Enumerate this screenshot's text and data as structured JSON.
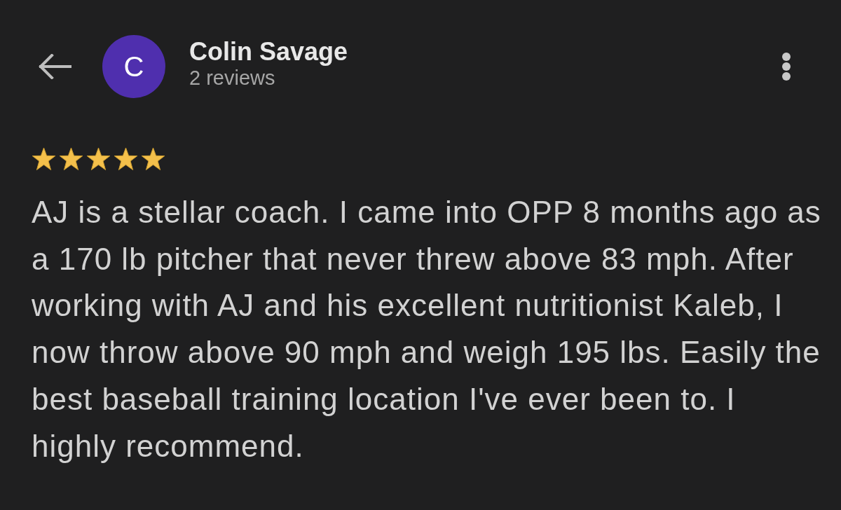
{
  "header": {
    "avatar_letter": "C",
    "name": "Colin Savage",
    "subtitle": "2 reviews"
  },
  "review": {
    "stars": 5,
    "text": "AJ is a stellar coach. I came into OPP 8 months ago as a 170 lb pitcher that never threw above 83 mph. After working with AJ and his excellent nutritionist Kaleb, I now throw above 90 mph and weigh 195 lbs. Easily the best baseball training location I've ever been to. I highly recommend."
  }
}
